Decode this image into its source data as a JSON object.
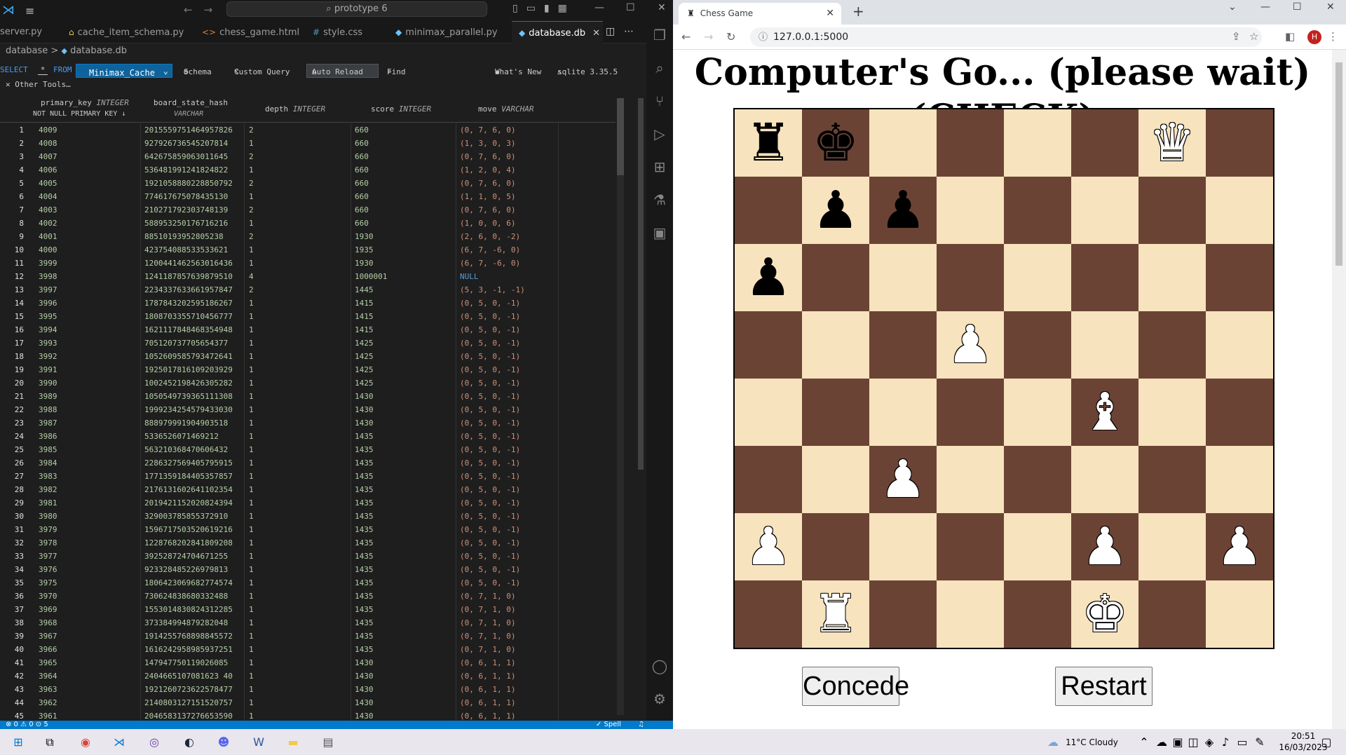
{
  "vscode": {
    "cmd_center": "prototype 6",
    "tabs": [
      {
        "label": "server.py",
        "icon": ""
      },
      {
        "label": "cache_item_schema.py",
        "icon": "⌂"
      },
      {
        "label": "chess_game.html",
        "icon": "<>"
      },
      {
        "label": "style.css",
        "icon": "#"
      },
      {
        "label": "minimax_parallel.py",
        "icon": "◆"
      },
      {
        "label": "database.db",
        "icon": "◆"
      }
    ],
    "breadcrumb": {
      "folder": "database",
      "sep": ">",
      "file": "database.db"
    },
    "toolbar": {
      "select": "SELECT",
      "star": "*",
      "from": "FROM",
      "table": "Minimax_Cache",
      "schema": "Schema",
      "custom_query": "Custom Query",
      "auto_reload": "Auto Reload",
      "find": "Find",
      "whats_new": "What's New",
      "sqlite_version": "sqlite 3.35.5",
      "other_tools": "Other Tools…"
    },
    "columns": [
      {
        "name": "primary_key",
        "type": "INTEGER",
        "sub": "NOT NULL PRIMARY KEY ↓"
      },
      {
        "name": "board_state_hash",
        "type": "",
        "sub": "VARCHAR"
      },
      {
        "name": "depth",
        "type": "INTEGER",
        "sub": ""
      },
      {
        "name": "score",
        "type": "INTEGER",
        "sub": ""
      },
      {
        "name": "move",
        "type": "VARCHAR",
        "sub": ""
      }
    ],
    "rows": [
      [
        "4009",
        "2015559751464957826",
        "2",
        "660",
        "(0, 7, 6, 0)"
      ],
      [
        "4008",
        "927926736545207814",
        "1",
        "660",
        "(1, 3, 0, 3)"
      ],
      [
        "4007",
        "642675859063011645",
        "2",
        "660",
        "(0, 7, 6, 0)"
      ],
      [
        "4006",
        "536481991241824822",
        "1",
        "660",
        "(1, 2, 0, 4)"
      ],
      [
        "4005",
        "1921058880228850792",
        "2",
        "660",
        "(0, 7, 6, 0)"
      ],
      [
        "4004",
        "774617675078435130",
        "1",
        "660",
        "(1, 1, 0, 5)"
      ],
      [
        "4003",
        "210271792303748139",
        "2",
        "660",
        "(0, 7, 6, 0)"
      ],
      [
        "4002",
        "588953250176716216",
        "1",
        "660",
        "(1, 0, 0, 6)"
      ],
      [
        "4001",
        "88510193952805238",
        "2",
        "1930",
        "(2, 6, 0, -2)"
      ],
      [
        "4000",
        "423754088533533621",
        "1",
        "1935",
        "(6, 7, -6, 0)"
      ],
      [
        "3999",
        "1200441462563016436",
        "1",
        "1930",
        "(6, 7, -6, 0)"
      ],
      [
        "3998",
        "1241187857639879510",
        "4",
        "1000001",
        "NULL"
      ],
      [
        "3997",
        "2234337633661957847",
        "2",
        "1445",
        "(5, 3, -1, -1)"
      ],
      [
        "3996",
        "1787843202595186267",
        "1",
        "1415",
        "(0, 5, 0, -1)"
      ],
      [
        "3995",
        "1808703355710456777",
        "1",
        "1415",
        "(0, 5, 0, -1)"
      ],
      [
        "3994",
        "1621117848468354948",
        "1",
        "1415",
        "(0, 5, 0, -1)"
      ],
      [
        "3993",
        "705120737705654377",
        "1",
        "1425",
        "(0, 5, 0, -1)"
      ],
      [
        "3992",
        "1052609585793472641",
        "1",
        "1425",
        "(0, 5, 0, -1)"
      ],
      [
        "3991",
        "1925017816109203929",
        "1",
        "1425",
        "(0, 5, 0, -1)"
      ],
      [
        "3990",
        "1002452198426305282",
        "1",
        "1425",
        "(0, 5, 0, -1)"
      ],
      [
        "3989",
        "1050549739365111308",
        "1",
        "1430",
        "(0, 5, 0, -1)"
      ],
      [
        "3988",
        "1999234254579433030",
        "1",
        "1430",
        "(0, 5, 0, -1)"
      ],
      [
        "3987",
        "888979991904903518",
        "1",
        "1430",
        "(0, 5, 0, -1)"
      ],
      [
        "3986",
        "5336526071469212",
        "1",
        "1435",
        "(0, 5, 0, -1)"
      ],
      [
        "3985",
        "563210368470606432",
        "1",
        "1435",
        "(0, 5, 0, -1)"
      ],
      [
        "3984",
        "2286327569405795915",
        "1",
        "1435",
        "(0, 5, 0, -1)"
      ],
      [
        "3983",
        "1771359184405357857",
        "1",
        "1435",
        "(0, 5, 0, -1)"
      ],
      [
        "3982",
        "2176131602641102354",
        "1",
        "1435",
        "(0, 5, 0, -1)"
      ],
      [
        "3981",
        "2019421152020824394",
        "1",
        "1435",
        "(0, 5, 0, -1)"
      ],
      [
        "3980",
        "329003785855372910",
        "1",
        "1435",
        "(0, 5, 0, -1)"
      ],
      [
        "3979",
        "1596717503520619216",
        "1",
        "1435",
        "(0, 5, 0, -1)"
      ],
      [
        "3978",
        "1228768202841809208",
        "1",
        "1435",
        "(0, 5, 0, -1)"
      ],
      [
        "3977",
        "392528724704671255",
        "1",
        "1435",
        "(0, 5, 0, -1)"
      ],
      [
        "3976",
        "923328485226979813",
        "1",
        "1435",
        "(0, 5, 0, -1)"
      ],
      [
        "3975",
        "1806423069682774574",
        "1",
        "1435",
        "(0, 5, 0, -1)"
      ],
      [
        "3970",
        "730624838680332488",
        "1",
        "1435",
        "(0, 7, 1, 0)"
      ],
      [
        "3969",
        "1553014830824312285",
        "1",
        "1435",
        "(0, 7, 1, 0)"
      ],
      [
        "3968",
        "373384994879282048",
        "1",
        "1435",
        "(0, 7, 1, 0)"
      ],
      [
        "3967",
        "1914255768898845572",
        "1",
        "1435",
        "(0, 7, 1, 0)"
      ],
      [
        "3966",
        "1616242958985937251",
        "1",
        "1435",
        "(0, 7, 1, 0)"
      ],
      [
        "3965",
        "147947750119026085",
        "1",
        "1430",
        "(0, 6, 1, 1)"
      ],
      [
        "3964",
        "2404665107081623 40",
        "1",
        "1430",
        "(0, 6, 1, 1)"
      ],
      [
        "3963",
        "1921260723622578477",
        "1",
        "1430",
        "(0, 6, 1, 1)"
      ],
      [
        "3962",
        "2140803127151520757",
        "1",
        "1430",
        "(0, 6, 1, 1)"
      ],
      [
        "3961",
        "2046583137276653590",
        "1",
        "1430",
        "(0, 6, 1, 1)"
      ]
    ],
    "status": {
      "left": "⊗ 0 ⚠ 0 ⊙ 5",
      "spell": "✓ Spell"
    }
  },
  "chrome": {
    "tab_title": "Chess Game",
    "url": "127.0.0.1:5000",
    "avatar": "H"
  },
  "game": {
    "status": "Computer's Go... (please wait) (CHECK)",
    "concede": "Concede",
    "restart": "Restart",
    "board": [
      [
        "♜",
        "♚",
        "",
        "",
        "",
        "",
        "♛",
        ""
      ],
      [
        "",
        "♟",
        "♟",
        "",
        "",
        "",
        "",
        ""
      ],
      [
        "♟",
        "",
        "",
        "",
        "",
        "",
        "",
        ""
      ],
      [
        "",
        "",
        "",
        "♙",
        "",
        "",
        "",
        ""
      ],
      [
        "",
        "",
        "",
        "",
        "",
        "♗",
        "",
        ""
      ],
      [
        "",
        "",
        "♙",
        "",
        "",
        "",
        "",
        ""
      ],
      [
        "♙",
        "",
        "",
        "",
        "",
        "♙",
        "",
        "♙"
      ],
      [
        "",
        "♖",
        "",
        "",
        "",
        "♔",
        "",
        ""
      ]
    ],
    "piece_colors": [
      [
        "b",
        "b",
        "",
        "",
        "",
        "",
        "w",
        ""
      ],
      [
        "",
        "b",
        "b",
        "",
        "",
        "",
        "",
        ""
      ],
      [
        "b",
        "",
        "",
        "",
        "",
        "",
        "",
        ""
      ],
      [
        "",
        "",
        "",
        "w",
        "",
        "",
        "",
        ""
      ],
      [
        "",
        "",
        "",
        "",
        "",
        "w",
        "",
        ""
      ],
      [
        "",
        "",
        "w",
        "",
        "",
        "",
        "",
        ""
      ],
      [
        "w",
        "",
        "",
        "",
        "",
        "w",
        "",
        "w"
      ],
      [
        "",
        "w",
        "",
        "",
        "",
        "w",
        "",
        ""
      ]
    ],
    "colors": {
      "dark": "#6b4335",
      "light": "#f7e3bd"
    }
  },
  "taskbar": {
    "weather": "11°C Cloudy",
    "time": "20:51",
    "date": "16/03/2023"
  }
}
